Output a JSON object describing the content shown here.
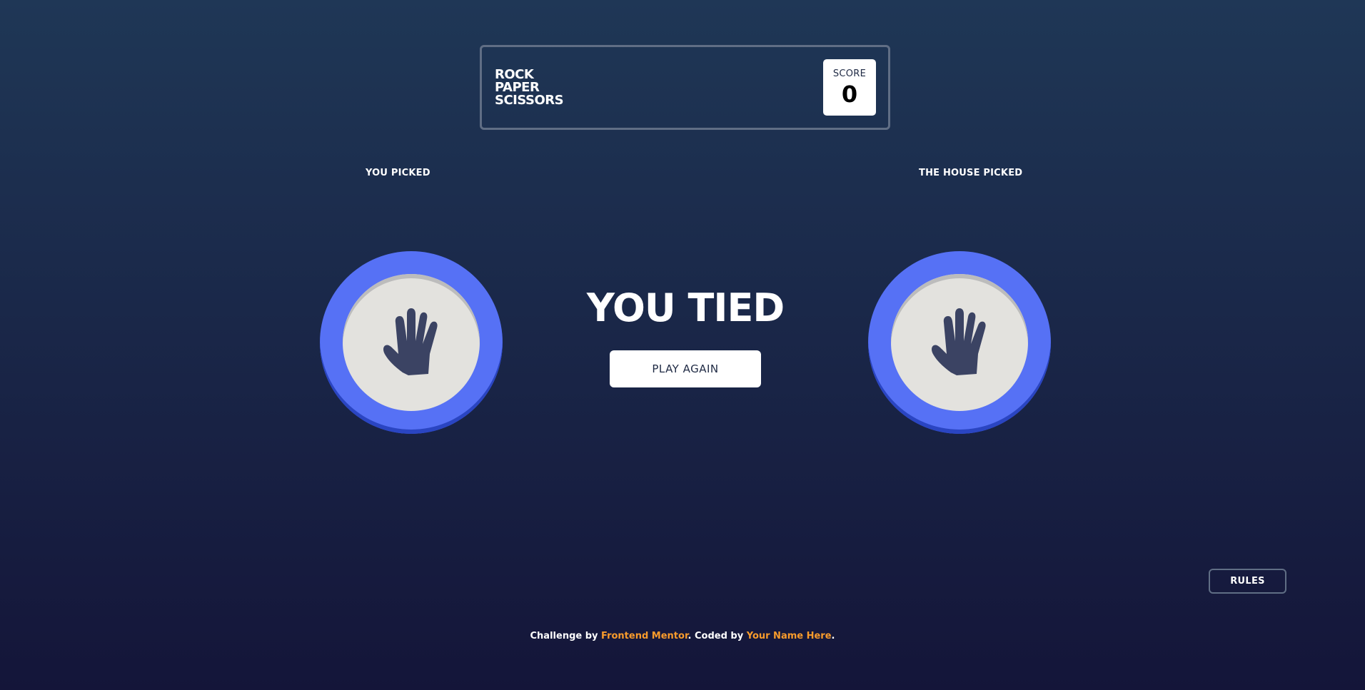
{
  "header": {
    "title_lines": [
      "ROCK",
      "PAPER",
      "SCISSORS"
    ],
    "score_label": "SCORE",
    "score_value": "0"
  },
  "game": {
    "you_picked_label": "YOU PICKED",
    "house_picked_label": "THE HOUSE PICKED",
    "you_pick": "paper-icon",
    "house_pick": "paper-icon",
    "result_text": "YOU TIED",
    "play_again_label": "PLAY AGAIN"
  },
  "rules_label": "RULES",
  "footer": {
    "prefix": "Challenge by ",
    "link1": "Frontend Mentor",
    "middle": ". Coded by ",
    "link2": "Your Name Here",
    "suffix": "."
  },
  "colors": {
    "paper_ring": "#5671f5",
    "token_face": "#e3e2de",
    "hand": "#3b4363",
    "footer_link": "#f89b2c",
    "background_top": "#1f3756",
    "background_bottom": "#141539"
  }
}
